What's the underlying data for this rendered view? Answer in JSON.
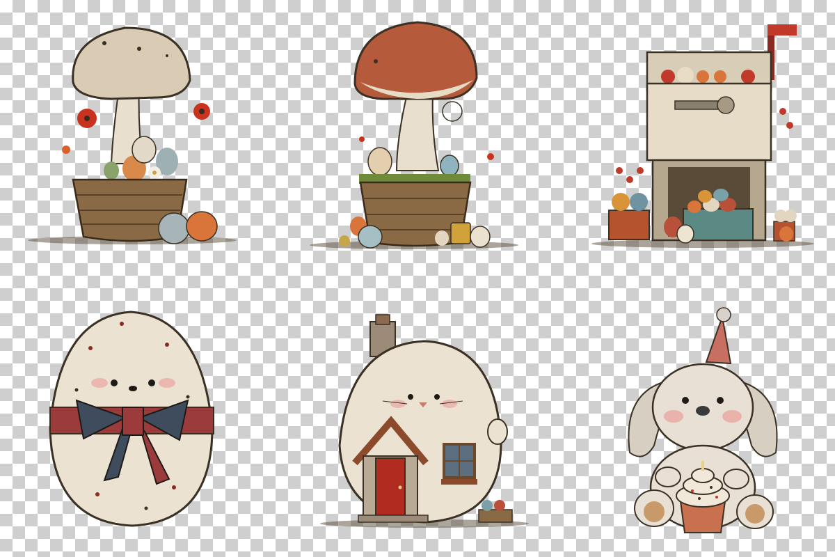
{
  "grid": {
    "background": "transparency-checkerboard",
    "columns": 3,
    "rows": 2
  },
  "illustrations": [
    {
      "name": "beige-mushroom-egg-basket",
      "colors": {
        "cap": "#d9cbb4",
        "basket": "#8a6a45",
        "flower": "#c8321e"
      }
    },
    {
      "name": "red-mushroom-egg-basket",
      "colors": {
        "cap": "#b65a3c",
        "basket": "#8a6a45",
        "flower": "#c8321e"
      }
    },
    {
      "name": "mailbox-easter-eggs",
      "colors": {
        "box": "#e6dcc8",
        "flag": "#c0392b",
        "pot": "#b5532f",
        "crate": "#5b8a85"
      }
    },
    {
      "name": "egg-with-bow",
      "colors": {
        "egg": "#ece2d2",
        "bow": "#3f4c5e",
        "ribbon": "#9c3b3b"
      }
    },
    {
      "name": "egg-cottage-with-face",
      "colors": {
        "egg": "#ece2d2",
        "door": "#b22b20",
        "roof": "#8b4a2b"
      }
    },
    {
      "name": "bunny-with-cupcake",
      "colors": {
        "fur": "#e8e0d4",
        "hat": "#c86f63",
        "cupcake": "#c9714f"
      }
    }
  ]
}
